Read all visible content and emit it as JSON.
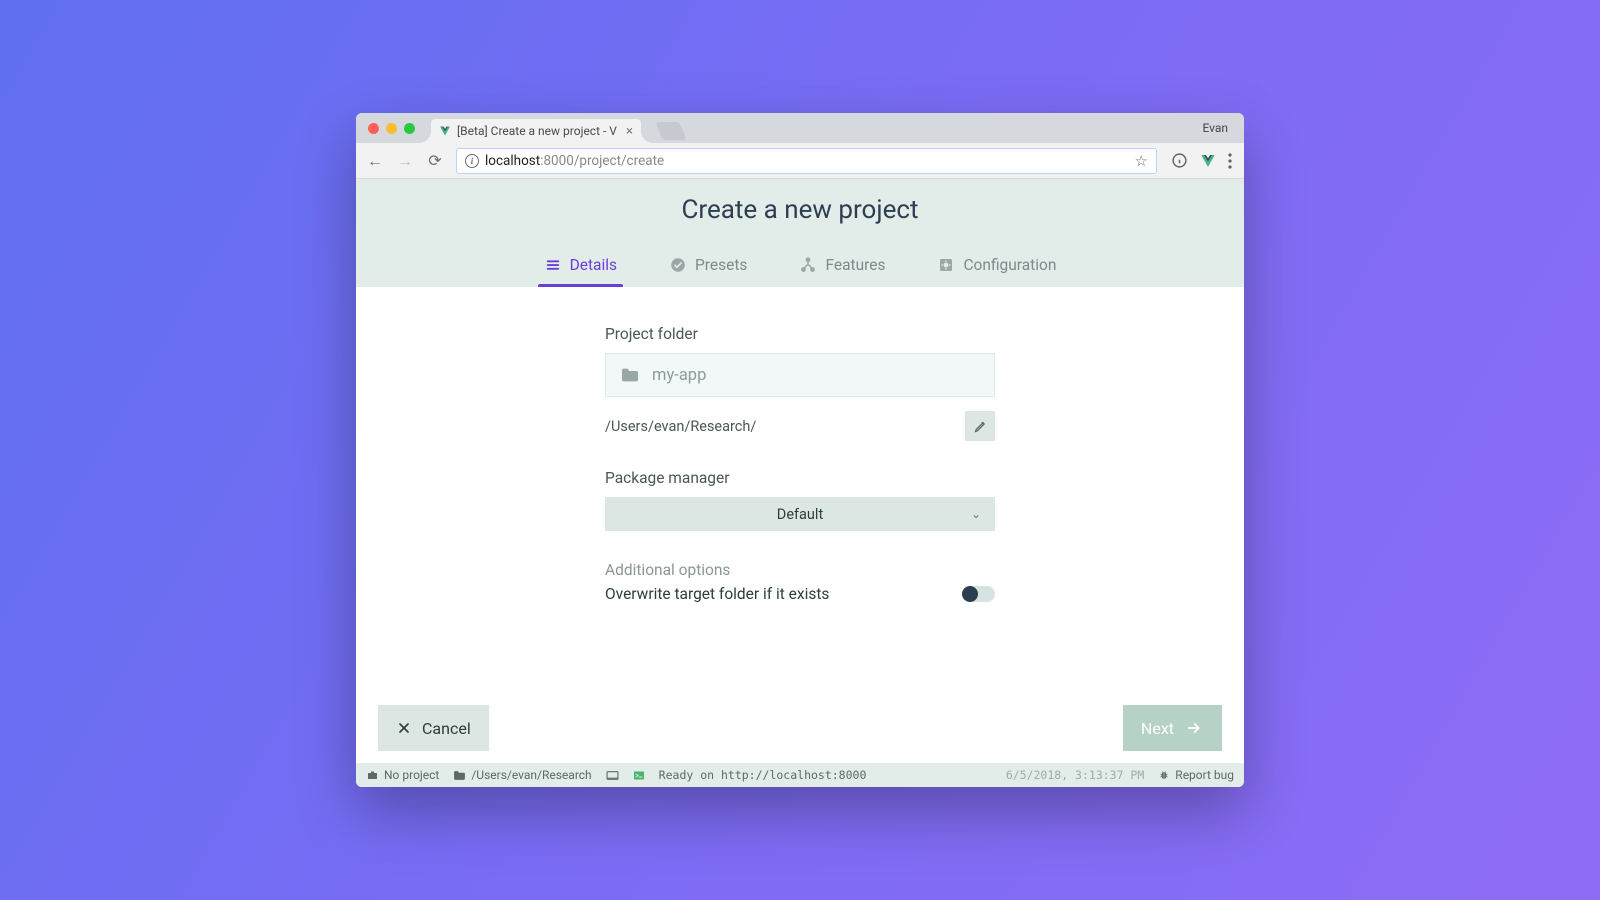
{
  "browser": {
    "profile_name": "Evan",
    "tab_title": "[Beta] Create a new project - V",
    "url_display_prefix": "localhost",
    "url_display_rest": ":8000/project/create"
  },
  "page": {
    "title": "Create a new project",
    "tabs": [
      {
        "label": "Details",
        "icon": "list-icon",
        "active": true
      },
      {
        "label": "Presets",
        "icon": "check-circle-icon",
        "active": false
      },
      {
        "label": "Features",
        "icon": "tree-icon",
        "active": false
      },
      {
        "label": "Configuration",
        "icon": "gear-icon",
        "active": false
      }
    ],
    "form": {
      "project_folder_label": "Project folder",
      "project_folder_placeholder": "my-app",
      "project_path": "/Users/evan/Research/",
      "package_manager_label": "Package manager",
      "package_manager_value": "Default",
      "additional_options_label": "Additional options",
      "overwrite_label": "Overwrite target folder if it exists",
      "overwrite_value": false
    },
    "buttons": {
      "cancel": "Cancel",
      "next": "Next"
    }
  },
  "status_bar": {
    "project": "No project",
    "cwd": "/Users/evan/Research",
    "ready": "Ready on http://localhost:8000",
    "timestamp": "6/5/2018, 3:13:37 PM",
    "report": "Report bug"
  }
}
